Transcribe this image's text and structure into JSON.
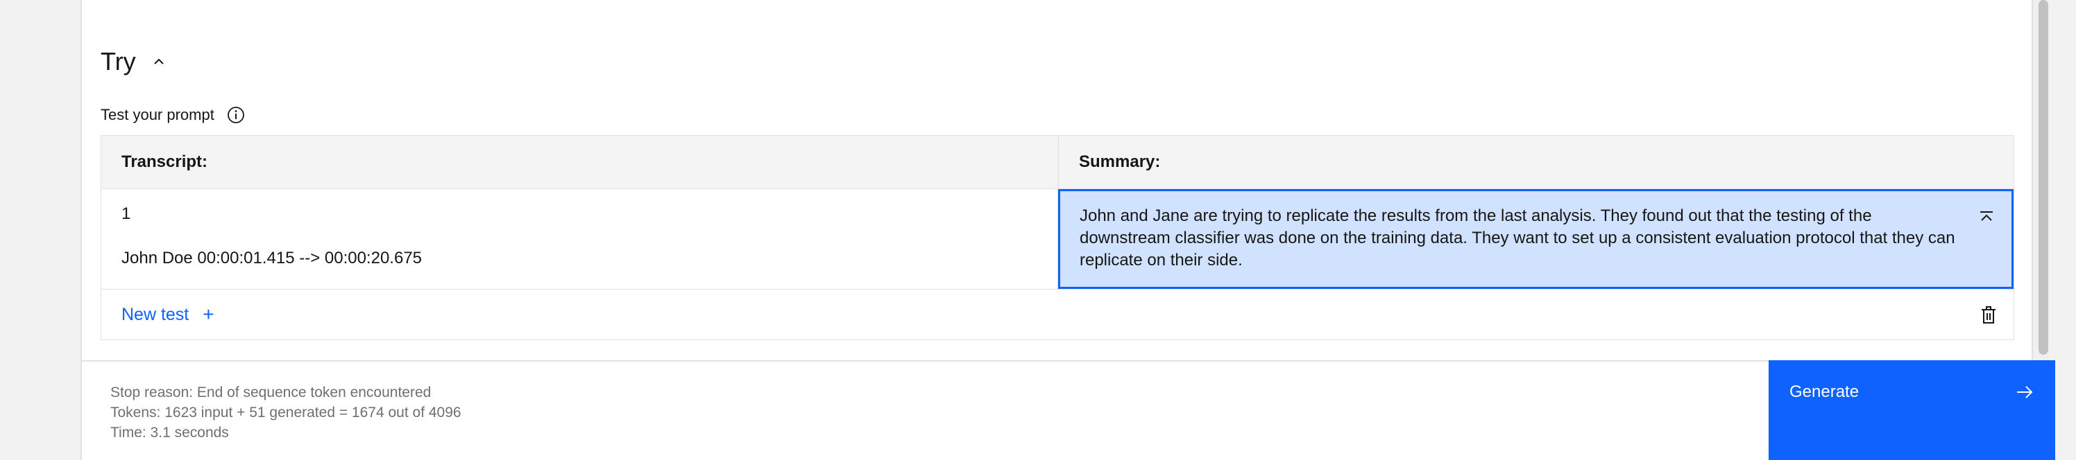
{
  "try_section": {
    "title": "Try",
    "toggle_icon": "chevron-up-icon",
    "subheader": "Test your prompt",
    "info_icon": "information-icon"
  },
  "table": {
    "columns": [
      "Transcript:",
      "Summary:"
    ],
    "rows": [
      {
        "transcript_line1": "1",
        "transcript_line2": "John Doe 00:00:01.415 --> 00:00:20.675",
        "summary": "John and Jane are trying to replicate the results from the last analysis. They found out that the testing of the downstream classifier was done on the training data. They want to set up a consistent evaluation protocol that they can replicate on their side."
      }
    ],
    "new_test_label": "New test"
  },
  "stats": {
    "stop_reason": "Stop reason: End of sequence token encountered",
    "tokens": "Tokens: 1623 input + 51 generated = 1674 out of 4096",
    "time": "Time: 3.1 seconds"
  },
  "generate": {
    "label": "Generate"
  },
  "colors": {
    "accent": "#0f62fe",
    "selected_cell_bg": "#d0e2ff",
    "header_bg": "#f4f4f4"
  }
}
